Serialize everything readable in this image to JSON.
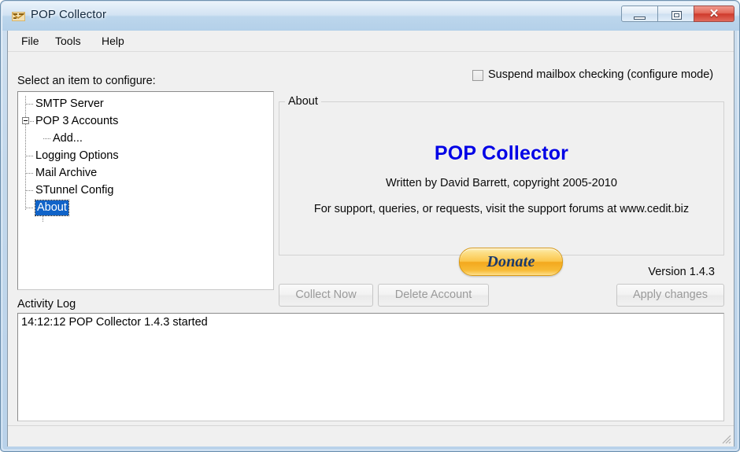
{
  "window": {
    "title": "POP Collector",
    "icon": "app-icon",
    "controls": {
      "minimize": "minimize-icon",
      "maximize": "maximize-icon",
      "close": "✕"
    }
  },
  "menu": {
    "items": [
      {
        "label": "File"
      },
      {
        "label": "Tools"
      },
      {
        "label": "Help"
      }
    ]
  },
  "suspend": {
    "label": "Suspend mailbox checking (configure mode)",
    "checked": false
  },
  "tree": {
    "caption": "Select an item to configure:",
    "nodes": [
      {
        "label": "SMTP Server",
        "level": 0,
        "expander": null,
        "selected": false
      },
      {
        "label": "POP 3 Accounts",
        "level": 0,
        "expander": "minus",
        "selected": false
      },
      {
        "label": "Add...",
        "level": 1,
        "expander": null,
        "selected": false
      },
      {
        "label": "Logging Options",
        "level": 0,
        "expander": null,
        "selected": false
      },
      {
        "label": "Mail Archive",
        "level": 0,
        "expander": null,
        "selected": false
      },
      {
        "label": "STunnel Config",
        "level": 0,
        "expander": null,
        "selected": false
      },
      {
        "label": "About",
        "level": 0,
        "expander": null,
        "selected": true
      }
    ]
  },
  "about": {
    "legend": "About",
    "product_title": "POP Collector",
    "credit": "Written by David Barrett, copyright 2005-2010",
    "support": "For support, queries, or requests, visit the support forums at www.cedit.biz",
    "donate_label": "Donate",
    "version": "Version 1.4.3"
  },
  "actions": {
    "collect_now": "Collect Now",
    "delete_account": "Delete Account",
    "apply_changes": "Apply changes"
  },
  "activity_log": {
    "caption": "Activity Log",
    "lines": [
      "14:12:12 POP Collector 1.4.3 started"
    ],
    "first_line": "14:12:12 POP Collector 1.4.3 started"
  },
  "status_bar": {
    "text": ""
  },
  "colors": {
    "title_accent": "#0000e6",
    "selection": "#1063c8",
    "donate_orange": "#f3a81e",
    "close_red": "#cf3a2c",
    "frame_blue": "#b9d2ea"
  }
}
